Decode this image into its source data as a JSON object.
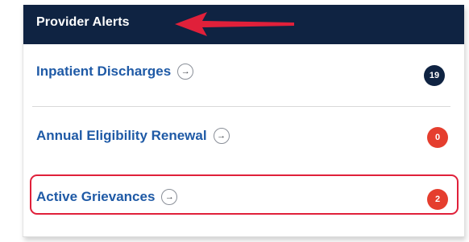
{
  "header": {
    "title": "Provider Alerts"
  },
  "alerts": [
    {
      "label": "Inpatient Discharges",
      "count": "19",
      "badge_color": "#0f2342"
    },
    {
      "label": "Annual Eligibility Renewal",
      "count": "0",
      "badge_color": "#e53e2e"
    },
    {
      "label": "Active Grievances",
      "count": "2",
      "badge_color": "#e53e2e"
    }
  ],
  "icons": {
    "go": "arrow-right-circle-icon"
  },
  "colors": {
    "header_bg": "#0f2342",
    "link": "#1f5aa6",
    "annotation_red": "#e0203a"
  }
}
